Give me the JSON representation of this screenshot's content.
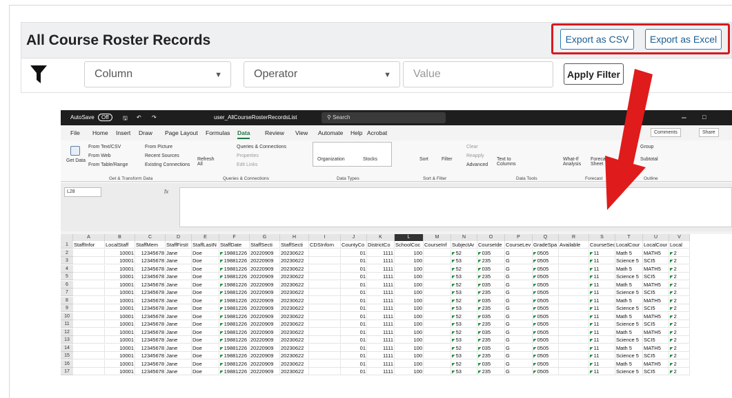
{
  "page": {
    "title": "All Course Roster Records"
  },
  "export": {
    "csv_label": "Export as CSV",
    "excel_label": "Export as Excel"
  },
  "filter": {
    "column_value": "Column",
    "operator_value": "Operator",
    "value_placeholder": "Value",
    "apply_label": "Apply Filter"
  },
  "colors": {
    "accent_blue": "#1a5d91",
    "highlight_red": "#d9181f",
    "excel_green": "#217346"
  },
  "excel": {
    "autosave": "AutoSave",
    "autosave_state": "Off",
    "filename": "user_AllCourseRosterRecordsList",
    "search": "Search",
    "menus": [
      "File",
      "Home",
      "Insert",
      "Draw",
      "Page Layout",
      "Formulas",
      "Data",
      "Review",
      "View",
      "Automate",
      "Help",
      "Acrobat"
    ],
    "active_menu": "Data",
    "comments": "Comments",
    "share": "Share",
    "ribbon": {
      "from_text": "From Text/CSV",
      "from_web": "From Web",
      "from_table": "From Table/Range",
      "get_data": "Get Data",
      "from_picture": "From Picture",
      "recent_sources": "Recent Sources",
      "existing_connections": "Existing Connections",
      "refresh_all": "Refresh All",
      "queries": "Queries & Connections",
      "properties": "Properties",
      "edit_links": "Edit Links",
      "organization": "Organization",
      "stocks": "Stocks",
      "sort": "Sort",
      "filter": "Filter",
      "clear": "Clear",
      "reapply": "Reapply",
      "advanced": "Advanced",
      "text_to_columns": "Text to Columns",
      "what_if": "What-If Analysis",
      "forecast_sheet": "Forecast Sheet",
      "outline_group": "Group",
      "subtotal": "Subtotal",
      "groups": [
        "Get & Transform Data",
        "Queries & Connections",
        "Data Types",
        "Sort & Filter",
        "Data Tools",
        "Forecast",
        "Outline"
      ]
    },
    "namebox": "L28",
    "fx": "fx",
    "columns": [
      "A",
      "B",
      "C",
      "D",
      "E",
      "F",
      "G",
      "H",
      "I",
      "J",
      "K",
      "L",
      "M",
      "N",
      "O",
      "P",
      "Q",
      "R",
      "S",
      "T",
      "U",
      "V"
    ],
    "headers": [
      "StaffInfor",
      "LocalStaff",
      "StaffMem",
      "StaffFirstI",
      "StaffLastN",
      "StaffDate",
      "StaffSecti",
      "StaffSecti",
      "CDSInforn",
      "CountyCo",
      "DistrictCo",
      "SchoolCoc",
      "CourseInf",
      "SubjectAr",
      "CourseIde",
      "CourseLev",
      "GradeSpa",
      "Available",
      "CourseSec",
      "LocalCour",
      "LocalCour",
      "Local"
    ],
    "rows": [
      [
        "",
        "10001",
        "12345678",
        "Jane",
        "Doe",
        "19881226",
        "20220909",
        "20230622",
        "",
        "01",
        "1111",
        "100",
        "",
        "52",
        "035",
        "G",
        "0505",
        "",
        "11",
        "Math 5",
        "MATH5",
        "2"
      ],
      [
        "",
        "10001",
        "12345678",
        "Jane",
        "Doe",
        "19881226",
        "20220909",
        "20230622",
        "",
        "01",
        "1111",
        "100",
        "",
        "53",
        "235",
        "G",
        "0505",
        "",
        "11",
        "Science 5",
        "SCI5",
        "2"
      ],
      [
        "",
        "10001",
        "12345678",
        "Jane",
        "Doe",
        "19881226",
        "20220909",
        "20230622",
        "",
        "01",
        "1111",
        "100",
        "",
        "52",
        "035",
        "G",
        "0505",
        "",
        "11",
        "Math 5",
        "MATH5",
        "2"
      ],
      [
        "",
        "10001",
        "12345678",
        "Jane",
        "Doe",
        "19881226",
        "20220909",
        "20230622",
        "",
        "01",
        "1111",
        "100",
        "",
        "53",
        "235",
        "G",
        "0505",
        "",
        "11",
        "Science 5",
        "SCI5",
        "2"
      ],
      [
        "",
        "10001",
        "12345678",
        "Jane",
        "Doe",
        "19881226",
        "20220909",
        "20230622",
        "",
        "01",
        "1111",
        "100",
        "",
        "52",
        "035",
        "G",
        "0505",
        "",
        "11",
        "Math 5",
        "MATH5",
        "2"
      ],
      [
        "",
        "10001",
        "12345678",
        "Jane",
        "Doe",
        "19881226",
        "20220909",
        "20230622",
        "",
        "01",
        "1111",
        "100",
        "",
        "53",
        "235",
        "G",
        "0505",
        "",
        "11",
        "Science 5",
        "SCI5",
        "2"
      ],
      [
        "",
        "10001",
        "12345678",
        "Jane",
        "Doe",
        "19881226",
        "20220909",
        "20230622",
        "",
        "01",
        "1111",
        "100",
        "",
        "52",
        "035",
        "G",
        "0505",
        "",
        "11",
        "Math 5",
        "MATH5",
        "2"
      ],
      [
        "",
        "10001",
        "12345678",
        "Jane",
        "Doe",
        "19881226",
        "20220909",
        "20230622",
        "",
        "01",
        "1111",
        "100",
        "",
        "53",
        "235",
        "G",
        "0505",
        "",
        "11",
        "Science 5",
        "SCI5",
        "2"
      ],
      [
        "",
        "10001",
        "12345678",
        "Jane",
        "Doe",
        "19881226",
        "20220909",
        "20230622",
        "",
        "01",
        "1111",
        "100",
        "",
        "52",
        "035",
        "G",
        "0505",
        "",
        "11",
        "Math 5",
        "MATH5",
        "2"
      ],
      [
        "",
        "10001",
        "12345678",
        "Jane",
        "Doe",
        "19881226",
        "20220909",
        "20230622",
        "",
        "01",
        "1111",
        "100",
        "",
        "53",
        "235",
        "G",
        "0505",
        "",
        "11",
        "Science 5",
        "SCI5",
        "2"
      ],
      [
        "",
        "10001",
        "12345678",
        "Jane",
        "Doe",
        "19881226",
        "20220909",
        "20230622",
        "",
        "01",
        "1111",
        "100",
        "",
        "52",
        "035",
        "G",
        "0505",
        "",
        "11",
        "Math 5",
        "MATH5",
        "2"
      ],
      [
        "",
        "10001",
        "12345678",
        "Jane",
        "Doe",
        "19881226",
        "20220909",
        "20230622",
        "",
        "01",
        "1111",
        "100",
        "",
        "53",
        "235",
        "G",
        "0505",
        "",
        "11",
        "Science 5",
        "SCI5",
        "2"
      ],
      [
        "",
        "10001",
        "12345678",
        "Jane",
        "Doe",
        "19881226",
        "20220909",
        "20230622",
        "",
        "01",
        "1111",
        "100",
        "",
        "52",
        "035",
        "G",
        "0505",
        "",
        "11",
        "Math 5",
        "MATH5",
        "2"
      ],
      [
        "",
        "10001",
        "12345678",
        "Jane",
        "Doe",
        "19881226",
        "20220909",
        "20230622",
        "",
        "01",
        "1111",
        "100",
        "",
        "53",
        "235",
        "G",
        "0505",
        "",
        "11",
        "Science 5",
        "SCI5",
        "2"
      ],
      [
        "",
        "10001",
        "12345678",
        "Jane",
        "Doe",
        "19881226",
        "20220909",
        "20230622",
        "",
        "01",
        "1111",
        "100",
        "",
        "52",
        "035",
        "G",
        "0505",
        "",
        "11",
        "Math 5",
        "MATH5",
        "2"
      ],
      [
        "",
        "10001",
        "12345678",
        "Jane",
        "Doe",
        "19881226",
        "20220909",
        "20230622",
        "",
        "01",
        "1111",
        "100",
        "",
        "53",
        "235",
        "G",
        "0505",
        "",
        "11",
        "Science 5",
        "SCI5",
        "2"
      ]
    ]
  }
}
